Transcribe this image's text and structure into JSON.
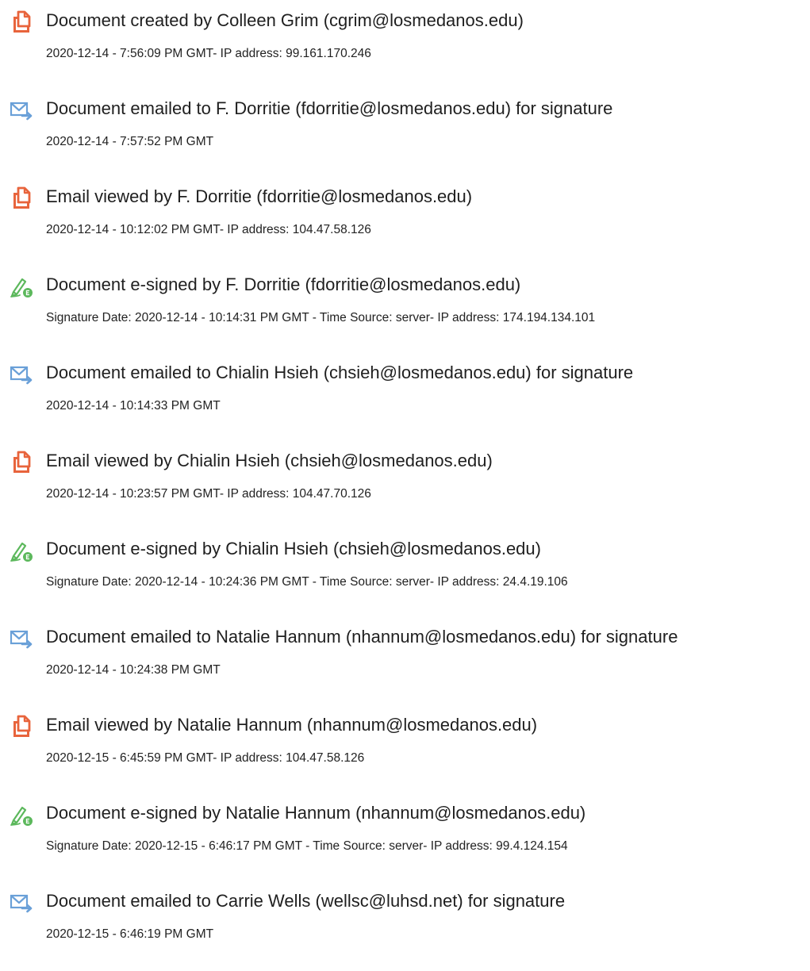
{
  "icon_colors": {
    "document": "#e8643c",
    "email": "#6aa0d8",
    "signed": "#5cb85c"
  },
  "events": [
    {
      "icon": "document-icon",
      "title": "Document created by Colleen Grim (cgrim@losmedanos.edu)",
      "detail": "2020-12-14 - 7:56:09 PM GMT- IP address: 99.161.170.246"
    },
    {
      "icon": "email-sent-icon",
      "title": "Document emailed to F. Dorritie (fdorritie@losmedanos.edu) for signature",
      "detail": "2020-12-14 - 7:57:52 PM GMT"
    },
    {
      "icon": "document-icon",
      "title": "Email viewed by F. Dorritie (fdorritie@losmedanos.edu)",
      "detail": "2020-12-14 - 10:12:02 PM GMT- IP address: 104.47.58.126"
    },
    {
      "icon": "pen-sign-icon",
      "title": "Document e-signed by F. Dorritie (fdorritie@losmedanos.edu)",
      "detail": "Signature Date: 2020-12-14 - 10:14:31 PM GMT - Time Source: server- IP address: 174.194.134.101"
    },
    {
      "icon": "email-sent-icon",
      "title": "Document emailed to Chialin Hsieh (chsieh@losmedanos.edu) for signature",
      "detail": "2020-12-14 - 10:14:33 PM GMT"
    },
    {
      "icon": "document-icon",
      "title": "Email viewed by Chialin Hsieh (chsieh@losmedanos.edu)",
      "detail": "2020-12-14 - 10:23:57 PM GMT- IP address: 104.47.70.126"
    },
    {
      "icon": "pen-sign-icon",
      "title": "Document e-signed by Chialin Hsieh (chsieh@losmedanos.edu)",
      "detail": "Signature Date: 2020-12-14 - 10:24:36 PM GMT - Time Source: server- IP address: 24.4.19.106"
    },
    {
      "icon": "email-sent-icon",
      "title": "Document emailed to Natalie Hannum (nhannum@losmedanos.edu) for signature",
      "detail": "2020-12-14 - 10:24:38 PM GMT"
    },
    {
      "icon": "document-icon",
      "title": "Email viewed by Natalie Hannum (nhannum@losmedanos.edu)",
      "detail": "2020-12-15 - 6:45:59 PM GMT- IP address: 104.47.58.126"
    },
    {
      "icon": "pen-sign-icon",
      "title": "Document e-signed by Natalie Hannum (nhannum@losmedanos.edu)",
      "detail": "Signature Date: 2020-12-15 - 6:46:17 PM GMT - Time Source: server- IP address: 99.4.124.154"
    },
    {
      "icon": "email-sent-icon",
      "title": "Document emailed to Carrie Wells (wellsc@luhsd.net) for signature",
      "detail": "2020-12-15 - 6:46:19 PM GMT"
    }
  ]
}
